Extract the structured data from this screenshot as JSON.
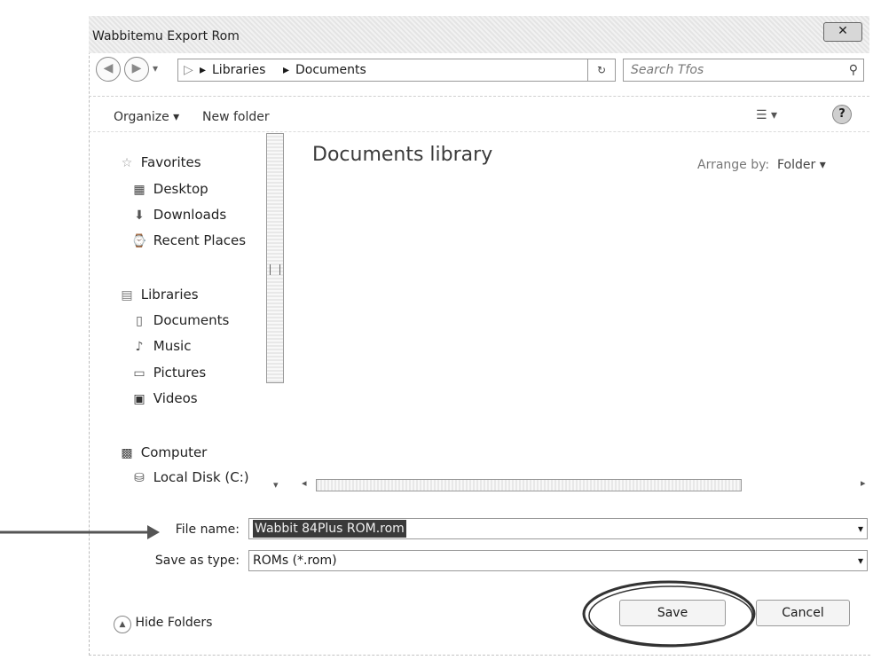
{
  "window": {
    "title": "Wabbitemu Export Rom",
    "close_glyph": "✕"
  },
  "nav": {
    "back_glyph": "◀",
    "forward_glyph": "▶",
    "recent_glyph": "▾",
    "address": {
      "separator": "▸",
      "segments": [
        "Libraries",
        "Documents"
      ],
      "dropdown_glyph": "▾"
    },
    "refresh_glyph": "↻",
    "search_placeholder": "Search Tfos",
    "search_icon_glyph": "⚲"
  },
  "toolbar": {
    "organize_label": "Organize ▾",
    "new_folder_label": "New folder",
    "view_glyph": "☰ ▾",
    "help_glyph": "?"
  },
  "sidebar": {
    "favorites": {
      "label": "Favorites",
      "icon": "star-icon",
      "glyph": "☆"
    },
    "favorite_items": [
      {
        "label": "Desktop",
        "icon": "desktop-icon",
        "glyph": "▦"
      },
      {
        "label": "Downloads",
        "icon": "downloads-icon",
        "glyph": "⬇"
      },
      {
        "label": "Recent Places",
        "icon": "recent-places-icon",
        "glyph": "⌚"
      }
    ],
    "libraries": {
      "label": "Libraries",
      "icon": "libraries-icon",
      "glyph": "▤"
    },
    "library_items": [
      {
        "label": "Documents",
        "icon": "documents-icon",
        "glyph": "▯"
      },
      {
        "label": "Music",
        "icon": "music-icon",
        "glyph": "♪"
      },
      {
        "label": "Pictures",
        "icon": "pictures-icon",
        "glyph": "▭"
      },
      {
        "label": "Videos",
        "icon": "videos-icon",
        "glyph": "▣"
      }
    ],
    "computer": {
      "label": "Computer",
      "icon": "computer-icon",
      "glyph": "▩"
    },
    "computer_items": [
      {
        "label": "Local Disk (C:)",
        "icon": "disk-icon",
        "glyph": "⛁"
      }
    ]
  },
  "main": {
    "library_title": "Documents library",
    "arrange_label": "Arrange by:",
    "arrange_value": "Folder ▾"
  },
  "fields": {
    "file_name_label": "File name:",
    "file_name_value": "Wabbit 84Plus ROM.rom",
    "save_type_label": "Save as type:",
    "save_type_value": "ROMs (*.rom)",
    "dropdown_glyph": "▾"
  },
  "footer": {
    "hide_folders_label": "Hide Folders",
    "hide_glyph": "▲",
    "save_label": "Save",
    "cancel_label": "Cancel"
  },
  "annotation": {
    "arrow_color": "#555555",
    "circle_color": "#333333"
  }
}
